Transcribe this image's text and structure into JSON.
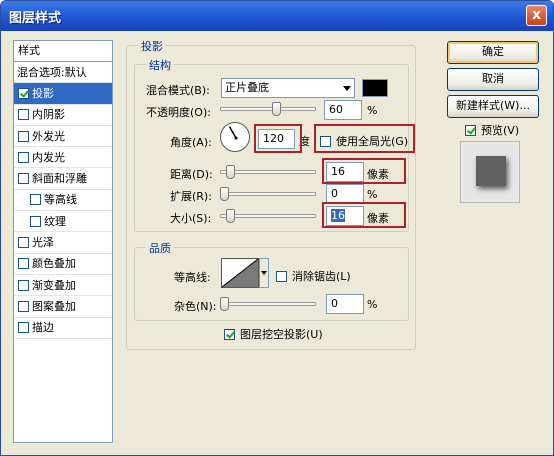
{
  "window": {
    "title": "图层样式",
    "close_glyph": "x"
  },
  "stylelist": {
    "header": "样式",
    "blending": "混合选项:默认",
    "items": [
      {
        "label": "投影",
        "checked": true,
        "selected": true
      },
      {
        "label": "内阴影",
        "checked": false
      },
      {
        "label": "外发光",
        "checked": false
      },
      {
        "label": "内发光",
        "checked": false
      },
      {
        "label": "斜面和浮雕",
        "checked": false
      },
      {
        "label": "等高线",
        "checked": false,
        "indent": true
      },
      {
        "label": "纹理",
        "checked": false,
        "indent": true
      },
      {
        "label": "光泽",
        "checked": false
      },
      {
        "label": "颜色叠加",
        "checked": false
      },
      {
        "label": "渐变叠加",
        "checked": false
      },
      {
        "label": "图案叠加",
        "checked": false
      },
      {
        "label": "描边",
        "checked": false
      }
    ]
  },
  "drop_shadow": {
    "title": "投影",
    "structure": {
      "title": "结构",
      "blend_mode_label": "混合模式(B):",
      "blend_mode_value": "正片叠底",
      "shadow_color": "#000000",
      "opacity_label": "不透明度(O):",
      "opacity_value": "60",
      "opacity_unit": "%",
      "angle_label": "角度(A):",
      "angle_value": "120",
      "angle_unit": "度",
      "global_light_label": "使用全局光(G)",
      "global_light_checked": false,
      "distance_label": "距离(D):",
      "distance_value": "16",
      "distance_unit": "像素",
      "spread_label": "扩展(R):",
      "spread_value": "0",
      "spread_unit": "%",
      "size_label": "大小(S):",
      "size_value": "16",
      "size_unit": "像素"
    },
    "quality": {
      "title": "品质",
      "contour_label": "等高线:",
      "antialias_label": "消除锯齿(L)",
      "antialias_checked": false,
      "noise_label": "杂色(N):",
      "noise_value": "0",
      "noise_unit": "%"
    },
    "knockout_label": "图层挖空投影(U)",
    "knockout_checked": true
  },
  "buttons": {
    "ok": "确定",
    "cancel": "取消",
    "new_style": "新建样式(W)...",
    "preview_label": "预览(V)",
    "preview_checked": true
  }
}
